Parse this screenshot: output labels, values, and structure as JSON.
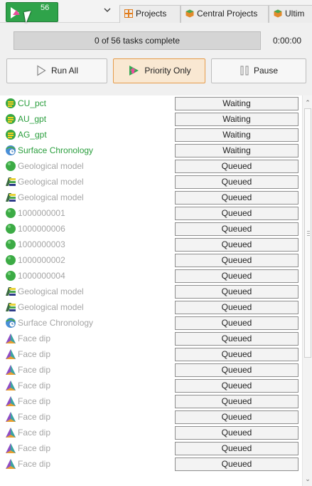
{
  "toolbar": {
    "queue_count": "56",
    "tabs": [
      {
        "label": "Projects",
        "icon": "grid-icon"
      },
      {
        "label": "Central Projects",
        "icon": "cube-icon"
      },
      {
        "label": "Ultim",
        "icon": "cube-icon"
      }
    ]
  },
  "progress": {
    "label": "0 of 56 tasks complete",
    "elapsed": "0:00:00",
    "fraction": 0
  },
  "actions": {
    "run_all": "Run All",
    "priority_only": "Priority Only",
    "pause": "Pause"
  },
  "colors": {
    "accent_green": "#2a9e3d",
    "priority_border": "#e69b4a",
    "dim_text": "#a5a5a5"
  },
  "tasks": [
    {
      "name": "CU_pct",
      "status": "Waiting",
      "icon": "numeric-model-icon",
      "active": true
    },
    {
      "name": "AU_gpt",
      "status": "Waiting",
      "icon": "numeric-model-icon",
      "active": true
    },
    {
      "name": "AG_gpt",
      "status": "Waiting",
      "icon": "numeric-model-icon",
      "active": true
    },
    {
      "name": "Surface Chronology",
      "status": "Waiting",
      "icon": "surface-chronology-icon",
      "active": true
    },
    {
      "name": "Geological model",
      "status": "Queued",
      "icon": "green-ball-icon",
      "active": false
    },
    {
      "name": "Geological model",
      "status": "Queued",
      "icon": "geo-model-icon",
      "active": false
    },
    {
      "name": "Geological model",
      "status": "Queued",
      "icon": "geo-model-icon",
      "active": false
    },
    {
      "name": "1000000001",
      "status": "Queued",
      "icon": "green-ball-icon",
      "active": false
    },
    {
      "name": "1000000006",
      "status": "Queued",
      "icon": "green-ball-icon",
      "active": false
    },
    {
      "name": "1000000003",
      "status": "Queued",
      "icon": "green-ball-icon",
      "active": false
    },
    {
      "name": "1000000002",
      "status": "Queued",
      "icon": "green-ball-icon",
      "active": false
    },
    {
      "name": "1000000004",
      "status": "Queued",
      "icon": "green-ball-icon",
      "active": false
    },
    {
      "name": "Geological model",
      "status": "Queued",
      "icon": "geo-model-icon",
      "active": false
    },
    {
      "name": "Geological model",
      "status": "Queued",
      "icon": "geo-model-icon",
      "active": false
    },
    {
      "name": "Surface Chronology",
      "status": "Queued",
      "icon": "surface-chronology-icon",
      "active": false
    },
    {
      "name": "Face dip",
      "status": "Queued",
      "icon": "face-dip-icon",
      "active": false
    },
    {
      "name": "Face dip",
      "status": "Queued",
      "icon": "face-dip-icon",
      "active": false
    },
    {
      "name": "Face dip",
      "status": "Queued",
      "icon": "face-dip-icon",
      "active": false
    },
    {
      "name": "Face dip",
      "status": "Queued",
      "icon": "face-dip-icon",
      "active": false
    },
    {
      "name": "Face dip",
      "status": "Queued",
      "icon": "face-dip-icon",
      "active": false
    },
    {
      "name": "Face dip",
      "status": "Queued",
      "icon": "face-dip-icon",
      "active": false
    },
    {
      "name": "Face dip",
      "status": "Queued",
      "icon": "face-dip-icon",
      "active": false
    },
    {
      "name": "Face dip",
      "status": "Queued",
      "icon": "face-dip-icon",
      "active": false
    },
    {
      "name": "Face dip",
      "status": "Queued",
      "icon": "face-dip-icon",
      "active": false
    }
  ]
}
